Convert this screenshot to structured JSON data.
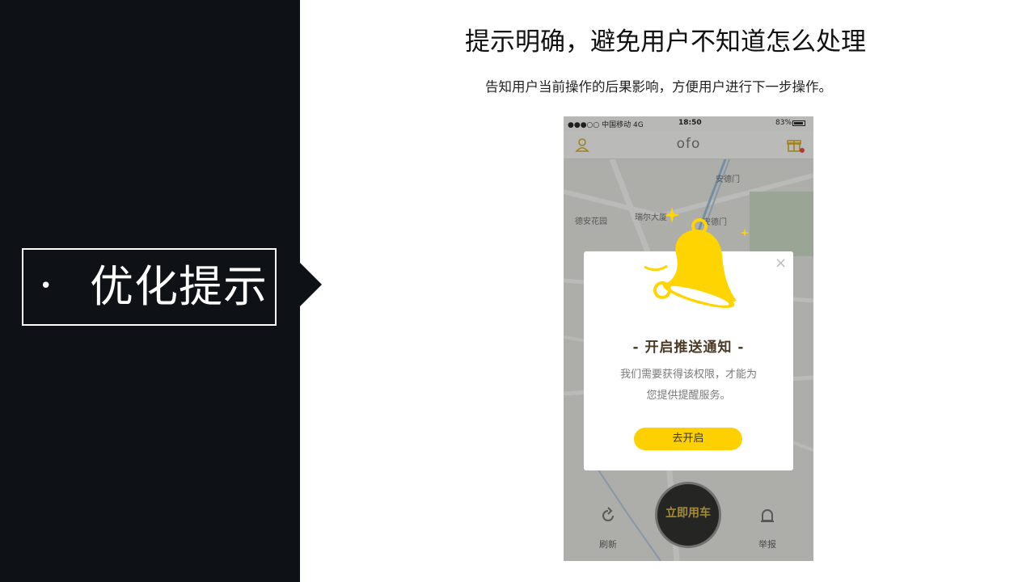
{
  "slide": {
    "section_bullet": "•",
    "section_title": "优化提示",
    "title": "提示明确，避免用户不知道怎么处理",
    "subtitle": "告知用户当前操作的后果影响，方便用户进行下一步操作。"
  },
  "phone": {
    "status": {
      "carrier": "●●●○○ 中国移动  4G",
      "time": "18:50",
      "battery": "83%"
    },
    "app_logo": "ofo",
    "map_labels": [
      "安德门",
      "德安花园",
      "瑞尔大厦",
      "安德门"
    ],
    "modal": {
      "close": "×",
      "title": "- 开启推送通知 -",
      "text_line1": "我们需要获得该权限，才能为",
      "text_line2": "您提供提醒服务。",
      "button": "去开启"
    },
    "bottom": {
      "refresh_label": "刷新",
      "report_label": "举报",
      "cta_label": "立即用车"
    }
  }
}
